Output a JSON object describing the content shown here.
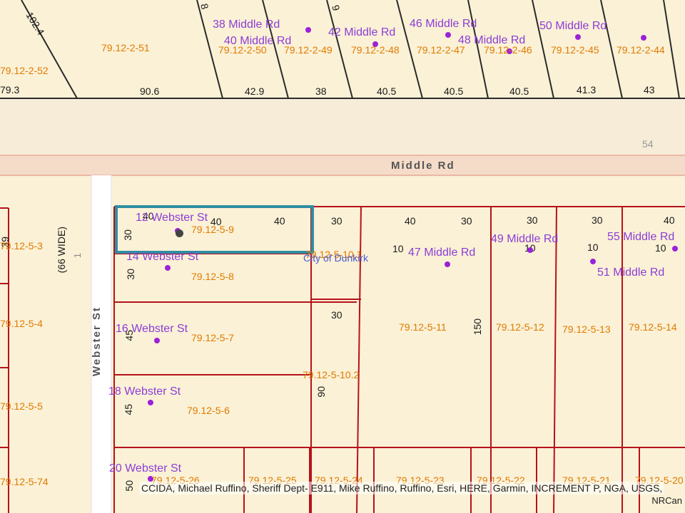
{
  "map": {
    "streets": {
      "middle_rd": "Middle Rd",
      "webster_st": "Webster St",
      "webster_width": "(66 WIDE)",
      "webster_number": "1"
    },
    "addresses": {
      "a38": "38 Middle Rd",
      "a40": "40 Middle Rd",
      "a42": "42 Middle Rd",
      "a46": "46 Middle Rd",
      "a48": "48 Middle Rd",
      "a50": "50 Middle Rd",
      "a12w": "12 Webster St",
      "a14w": "14 Webster St",
      "a16w": "16 Webster St",
      "a18w": "18 Webster St",
      "a20w": "20 Webster St",
      "a47": "47 Middle Rd",
      "a49": "49 Middle Rd",
      "a51": "51 Middle Rd",
      "a55": "55 Middle Rd",
      "city": "City of Dunkirk"
    },
    "parcels": {
      "p251": "79.12-2-51",
      "p252": "79.12-2-52",
      "p250": "79.12-2-50",
      "p249": "79.12-2-49",
      "p248": "79.12-2-48",
      "p247": "79.12-2-47",
      "p246": "79.12-2-46",
      "p245": "79.12-2-45",
      "p244": "79.12-2-44",
      "p53": "79.12-5-3",
      "p54": "79.12-5-4",
      "p55": "79.12-5-5",
      "p574": "79.12-5-74",
      "p59": "79.12-5-9",
      "p58": "79.12-5-8",
      "p57": "79.12-5-7",
      "p56": "79.12-5-6",
      "p526": "79.12-5-26",
      "p5101": "79.12-5-10.1",
      "p5102": "79.12-5-10.2",
      "p511": "79.12-5-11",
      "p512": "79.12-5-12",
      "p513": "79.12-5-13",
      "p514": "79.12-5-14",
      "p525": "79.12-5-25",
      "p524": "79.12-5-24",
      "p523": "79.12-5-23",
      "p522": "79.12-5-22",
      "p521": "79.12-5-21",
      "p520": "79.12-5-20"
    },
    "dims": {
      "d1024": "102.4",
      "d793": "79.3",
      "d906": "90.6",
      "d429": "42.9",
      "d38": "38",
      "d405a": "40.5",
      "d405b": "40.5",
      "d405c": "40.5",
      "d413": "41.3",
      "d43": "43",
      "d54": "54",
      "d8": "8",
      "d9": "9",
      "w40a": "40",
      "w40b": "40",
      "w40c": "40",
      "w30a": "30",
      "w40d": "40",
      "w30b": "30",
      "w30c": "30",
      "w30d": "30",
      "w40e": "40",
      "w30side": "30",
      "w30side2": "30",
      "w45a": "45",
      "w45b": "45",
      "w50": "50",
      "w30mid": "30",
      "w90": "90",
      "w10a": "10",
      "w10b": "10",
      "w10c": "10",
      "w10d": "10",
      "w150": "150",
      "w39": "39"
    },
    "attribution": "CCIDA, Michael Ruffino, Sheriff Dept- E911, Mike Ruffino, Ruffino, Esri, HERE, Garmin, INCREMENT P, NGA, USGS,",
    "attribution2": "NRCan",
    "colors": {
      "background": "#fbf1d6",
      "road": "#f7e6cf",
      "parcel_line": "#b5121b",
      "highlight": "#2f8ea3",
      "address": "#8a3ed6",
      "parcel_id": "#e07a00"
    }
  }
}
